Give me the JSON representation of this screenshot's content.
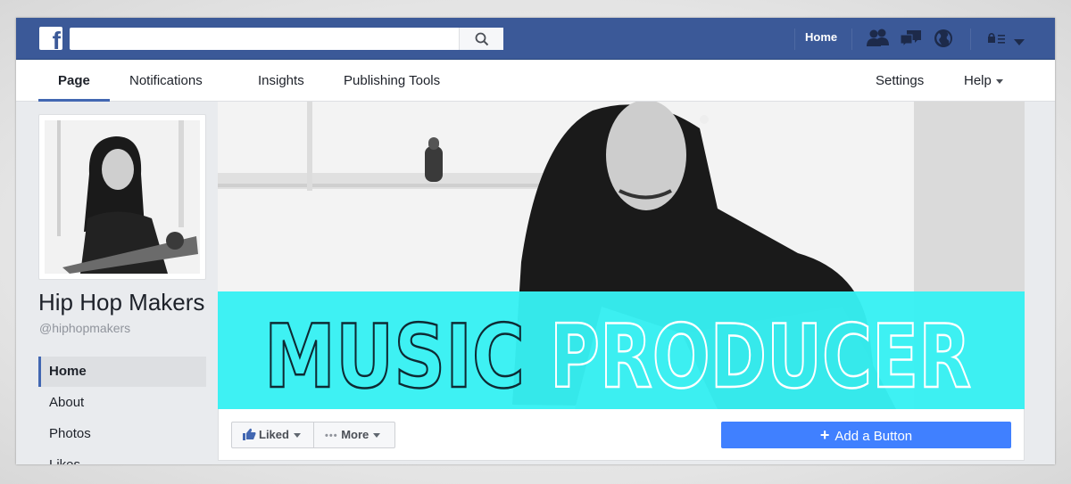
{
  "topbar": {
    "logo": "f",
    "search_placeholder": "",
    "home_label": "Home",
    "icons": [
      "friends-icon",
      "messages-icon",
      "globe-icon",
      "lock-menu-icon",
      "chevron-down-icon"
    ],
    "color": "#3b5998"
  },
  "nav": {
    "tabs": [
      {
        "label": "Page"
      },
      {
        "label": "Notifications"
      },
      {
        "label": "Insights"
      },
      {
        "label": "Publishing Tools"
      }
    ],
    "settings_label": "Settings",
    "help_label": "Help"
  },
  "profile": {
    "name": "Hip Hop Makers",
    "handle": "@hiphopmakers"
  },
  "sidebar": {
    "items": [
      {
        "label": "Home"
      },
      {
        "label": "About"
      },
      {
        "label": "Photos"
      },
      {
        "label": "Likes"
      }
    ]
  },
  "cover": {
    "word1": "MUSIC",
    "word2": "PRODUCER",
    "band_color": "#36f0f2"
  },
  "actions": {
    "liked_label": "Liked",
    "more_label": "More",
    "add_button_label": "Add a Button",
    "add_button_color": "#4080ff"
  }
}
